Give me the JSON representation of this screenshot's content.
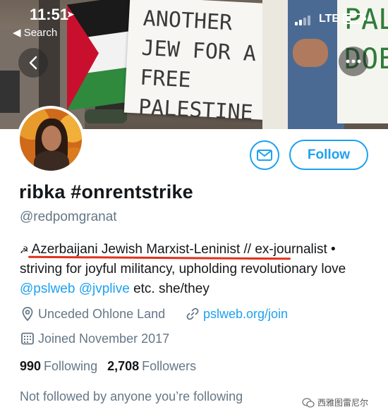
{
  "status_bar": {
    "time": "11:51",
    "back_label": "◀ Search",
    "carrier": "LTE",
    "battery_level": 0.3
  },
  "banner": {
    "sign_text": "ANOTHER JEW FOR A FREE PALESTINE",
    "sign_right_text": "PAL DOES"
  },
  "profile": {
    "name": "ribka #onrentstrike",
    "handle": "@redpomgranat",
    "follow_label": "Follow",
    "bio": {
      "symbol": "☭",
      "part1": "Azerbaijani Jewish Marxist-Leninist // ex-journalist • striving for joyful militancy, upholding revolutionary love ",
      "mention1": "@pslweb",
      "mention2": "@jvplive",
      "part2": " etc. she/they"
    },
    "location": "Unceded Ohlone Land",
    "website": "pslweb.org/join",
    "joined": "Joined November 2017",
    "following_count": "990",
    "following_label": "Following",
    "followers_count": "2,708",
    "followers_label": "Followers",
    "not_followed": "Not followed by anyone you’re following"
  },
  "watermark": "西雅图雷尼尔",
  "colors": {
    "accent": "#1da1f2",
    "muted": "#657786",
    "highlight_underline": "#e0311e"
  }
}
